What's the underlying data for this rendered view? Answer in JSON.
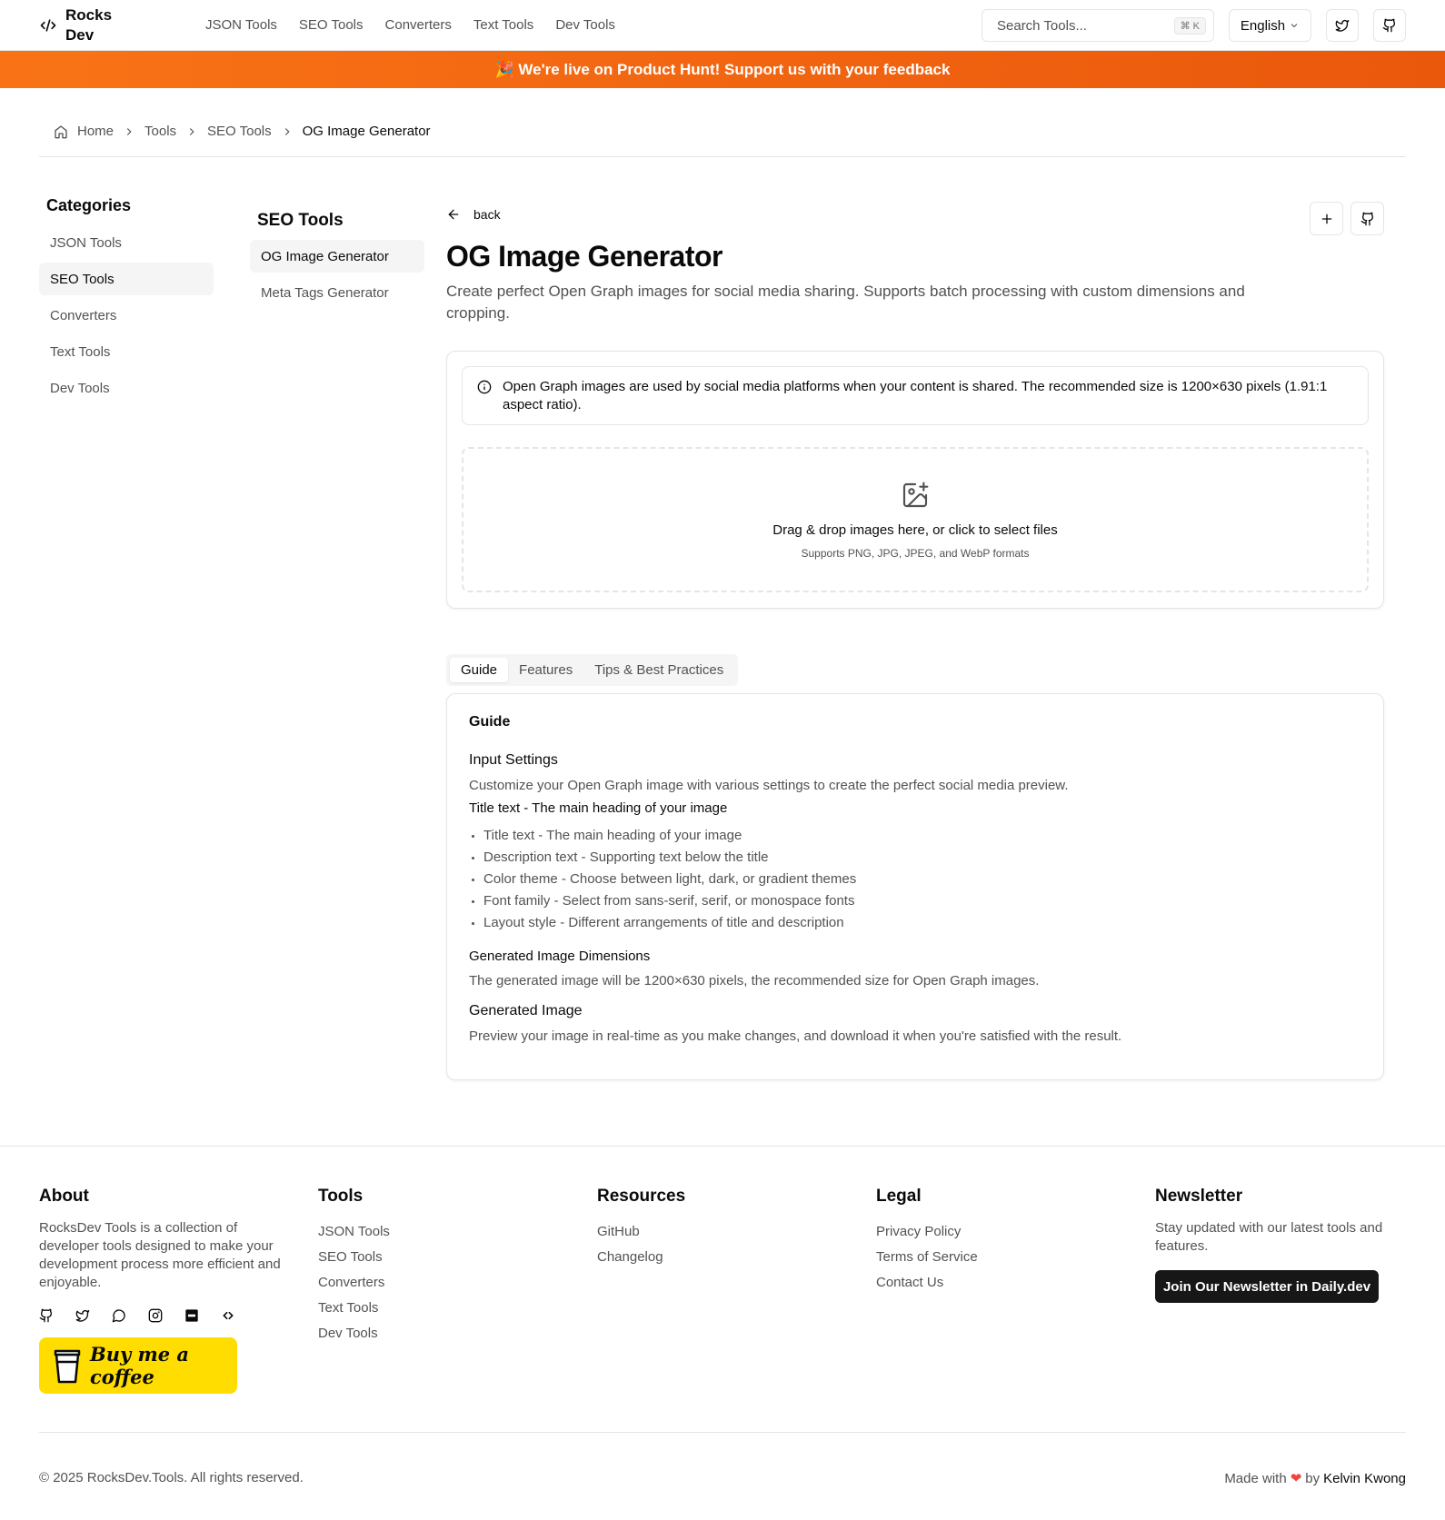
{
  "header": {
    "logo_line1": "Rocks",
    "logo_line2": "Dev",
    "nav": [
      "JSON Tools",
      "SEO Tools",
      "Converters",
      "Text Tools",
      "Dev Tools"
    ],
    "search_placeholder": "Search Tools...",
    "search_shortcut": "⌘ K",
    "language": "English"
  },
  "banner": {
    "text": "🎉 We're live on Product Hunt! Support us with your feedback"
  },
  "breadcrumb": [
    "Home",
    "Tools",
    "SEO Tools",
    "OG Image Generator"
  ],
  "categories": {
    "title": "Categories",
    "items": [
      "JSON Tools",
      "SEO Tools",
      "Converters",
      "Text Tools",
      "Dev Tools"
    ],
    "active": "SEO Tools"
  },
  "subnav": {
    "title": "SEO Tools",
    "items": [
      "OG Image Generator",
      "Meta Tags Generator"
    ],
    "active": "OG Image Generator"
  },
  "main": {
    "back_label": "back",
    "title": "OG Image Generator",
    "subtitle": "Create perfect Open Graph images for social media sharing. Supports batch processing with custom dimensions and cropping.",
    "info": "Open Graph images are used by social media platforms when your content is shared. The recommended size is 1200×630 pixels (1.91:1 aspect ratio).",
    "drop_title": "Drag & drop images here, or click to select files",
    "drop_sub": "Supports PNG, JPG, JPEG, and WebP formats",
    "tabs": [
      "Guide",
      "Features",
      "Tips & Best Practices"
    ],
    "active_tab": "Guide"
  },
  "guide": {
    "heading": "Guide",
    "input_settings": "Input Settings",
    "input_desc": "Customize your Open Graph image with various settings to create the perfect social media preview.",
    "title_line": "Title text - The main heading of your image",
    "bullets": [
      "Title text - The main heading of your image",
      "Description text - Supporting text below the title",
      "Color theme - Choose between light, dark, or gradient themes",
      "Font family - Select from sans-serif, serif, or monospace fonts",
      "Layout style - Different arrangements of title and description"
    ],
    "dimensions_heading": "Generated Image Dimensions",
    "dimensions_desc": "The generated image will be 1200×630 pixels, the recommended size for Open Graph images.",
    "generated_heading": "Generated Image",
    "generated_desc": "Preview your image in real-time as you make changes, and download it when you're satisfied with the result."
  },
  "footer": {
    "about_title": "About",
    "about_text": "RocksDev Tools is a collection of developer tools designed to make your development process more efficient and enjoyable.",
    "coffee_label": "Buy me a coffee",
    "tools_title": "Tools",
    "tools": [
      "JSON Tools",
      "SEO Tools",
      "Converters",
      "Text Tools",
      "Dev Tools"
    ],
    "resources_title": "Resources",
    "resources": [
      "GitHub",
      "Changelog"
    ],
    "legal_title": "Legal",
    "legal": [
      "Privacy Policy",
      "Terms of Service",
      "Contact Us"
    ],
    "newsletter_title": "Newsletter",
    "newsletter_text": "Stay updated with our latest tools and features.",
    "newsletter_button": "Join Our Newsletter in Daily.dev",
    "copyright": "© 2025 RocksDev.Tools. All rights reserved.",
    "made_with": "Made with",
    "made_by": "by",
    "author": "Kelvin Kwong"
  },
  "colors": {
    "accent": "#f97316",
    "accent_dark": "#ea580c",
    "coffee": "#ffdd00",
    "heart": "#ef4444"
  }
}
